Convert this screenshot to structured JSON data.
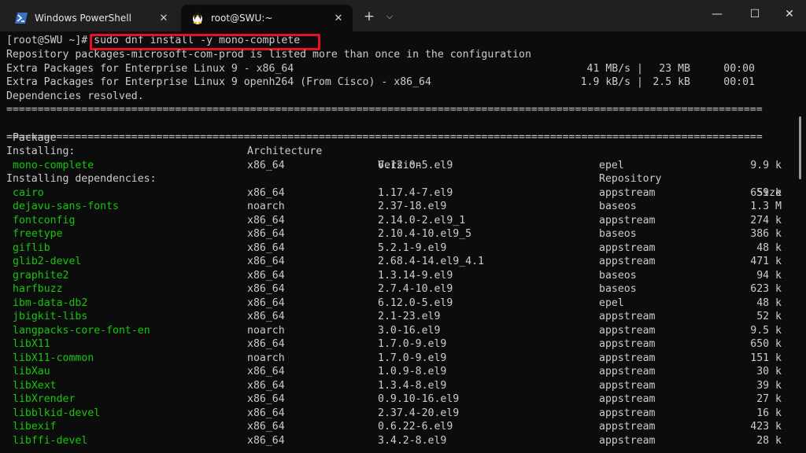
{
  "tabs": [
    {
      "label": "Windows PowerShell",
      "icon": "powershell-icon"
    },
    {
      "label": "root@SWU:~",
      "icon": "linux-penguin-icon"
    }
  ],
  "window_controls": {
    "new_tab": "+",
    "dropdown": "⌄",
    "minimize": "—",
    "maximize": "☐",
    "close": "✕"
  },
  "colors": {
    "background": "#0c0c0c",
    "text": "#cccccc",
    "package_green": "#16c60c",
    "highlight_red": "#e81123"
  },
  "terminal": {
    "prompt": "[root@SWU ~]# ",
    "command": "sudo dnf install -y mono-complete",
    "info": [
      {
        "text": "Repository packages-microsoft-com-prod is listed more than once in the configuration",
        "rate": "",
        "size": "",
        "time": ""
      },
      {
        "text": "Extra Packages for Enterprise Linux 9 - x86_64",
        "rate": "41 MB/s |",
        "size": "23 MB",
        "time": "00:00"
      },
      {
        "text": "Extra Packages for Enterprise Linux 9 openh264 (From Cisco) - x86_64",
        "rate": "1.9 kB/s |",
        "size": "2.5 kB",
        "time": "00:01"
      },
      {
        "text": "Dependencies resolved.",
        "rate": "",
        "size": "",
        "time": ""
      }
    ],
    "separator": "=========================================================================================================================",
    "headers": {
      "package": " Package",
      "arch": "Architecture",
      "version": "Version",
      "repo": "Repository",
      "size": "Size"
    },
    "installing_label": "Installing:",
    "installing": [
      {
        "name": "mono-complete",
        "arch": "x86_64",
        "version": "6.12.0-5.el9",
        "repo": "epel",
        "size": "9.9 k"
      }
    ],
    "deps_label": "Installing dependencies:",
    "dependencies": [
      {
        "name": "cairo",
        "arch": "x86_64",
        "version": "1.17.4-7.el9",
        "repo": "appstream",
        "size": "659 k"
      },
      {
        "name": "dejavu-sans-fonts",
        "arch": "noarch",
        "version": "2.37-18.el9",
        "repo": "baseos",
        "size": "1.3 M"
      },
      {
        "name": "fontconfig",
        "arch": "x86_64",
        "version": "2.14.0-2.el9_1",
        "repo": "appstream",
        "size": "274 k"
      },
      {
        "name": "freetype",
        "arch": "x86_64",
        "version": "2.10.4-10.el9_5",
        "repo": "baseos",
        "size": "386 k"
      },
      {
        "name": "giflib",
        "arch": "x86_64",
        "version": "5.2.1-9.el9",
        "repo": "appstream",
        "size": "48 k"
      },
      {
        "name": "glib2-devel",
        "arch": "x86_64",
        "version": "2.68.4-14.el9_4.1",
        "repo": "appstream",
        "size": "471 k"
      },
      {
        "name": "graphite2",
        "arch": "x86_64",
        "version": "1.3.14-9.el9",
        "repo": "baseos",
        "size": "94 k"
      },
      {
        "name": "harfbuzz",
        "arch": "x86_64",
        "version": "2.7.4-10.el9",
        "repo": "baseos",
        "size": "623 k"
      },
      {
        "name": "ibm-data-db2",
        "arch": "x86_64",
        "version": "6.12.0-5.el9",
        "repo": "epel",
        "size": "48 k"
      },
      {
        "name": "jbigkit-libs",
        "arch": "x86_64",
        "version": "2.1-23.el9",
        "repo": "appstream",
        "size": "52 k"
      },
      {
        "name": "langpacks-core-font-en",
        "arch": "noarch",
        "version": "3.0-16.el9",
        "repo": "appstream",
        "size": "9.5 k"
      },
      {
        "name": "libX11",
        "arch": "x86_64",
        "version": "1.7.0-9.el9",
        "repo": "appstream",
        "size": "650 k"
      },
      {
        "name": "libX11-common",
        "arch": "noarch",
        "version": "1.7.0-9.el9",
        "repo": "appstream",
        "size": "151 k"
      },
      {
        "name": "libXau",
        "arch": "x86_64",
        "version": "1.0.9-8.el9",
        "repo": "appstream",
        "size": "30 k"
      },
      {
        "name": "libXext",
        "arch": "x86_64",
        "version": "1.3.4-8.el9",
        "repo": "appstream",
        "size": "39 k"
      },
      {
        "name": "libXrender",
        "arch": "x86_64",
        "version": "0.9.10-16.el9",
        "repo": "appstream",
        "size": "27 k"
      },
      {
        "name": "libblkid-devel",
        "arch": "x86_64",
        "version": "2.37.4-20.el9",
        "repo": "appstream",
        "size": "16 k"
      },
      {
        "name": "libexif",
        "arch": "x86_64",
        "version": "0.6.22-6.el9",
        "repo": "appstream",
        "size": "423 k"
      },
      {
        "name": "libffi-devel",
        "arch": "x86_64",
        "version": "3.4.2-8.el9",
        "repo": "appstream",
        "size": "28 k"
      }
    ]
  }
}
